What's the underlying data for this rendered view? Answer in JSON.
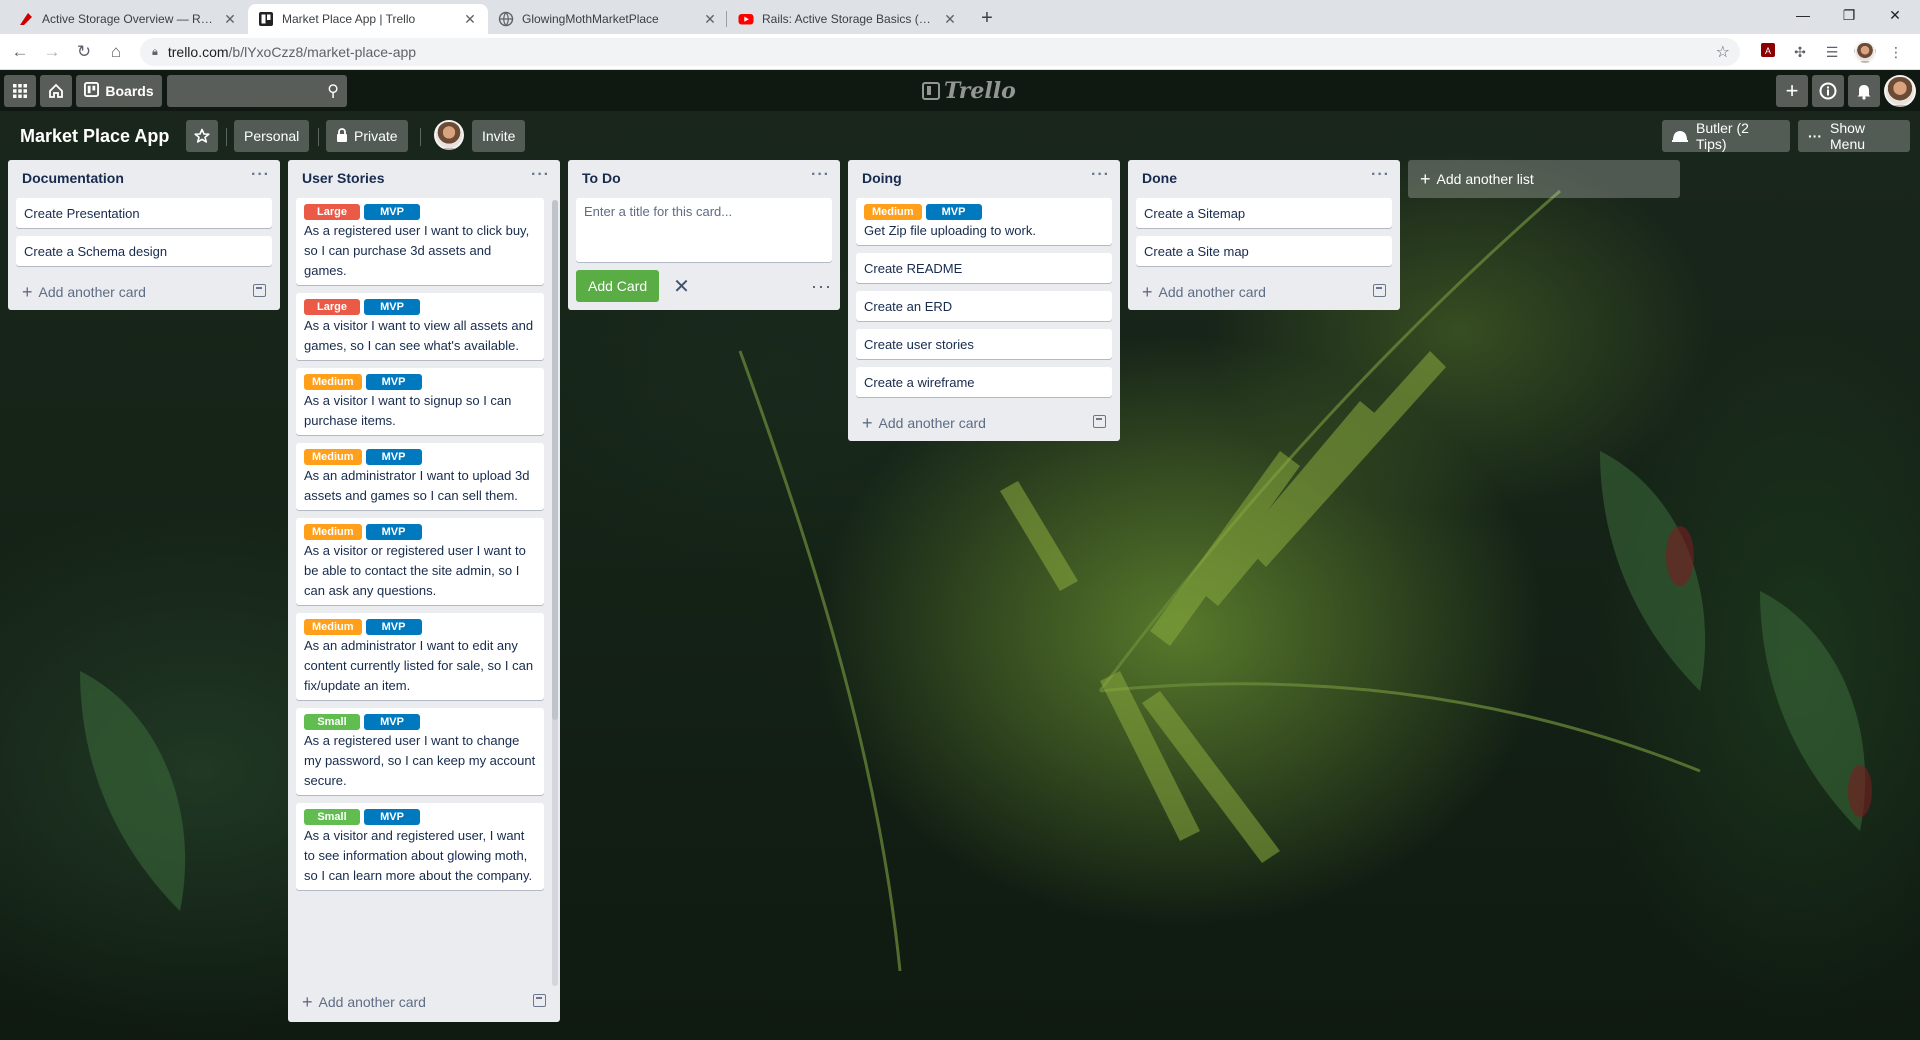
{
  "browser": {
    "tabs": [
      {
        "title": "Active Storage Overview — Ruby",
        "active": false
      },
      {
        "title": "Market Place App | Trello",
        "active": true
      },
      {
        "title": "GlowingMothMarketPlace",
        "active": false
      },
      {
        "title": "Rails: Active Storage Basics (File U",
        "active": false
      }
    ],
    "url_host": "trello.com",
    "url_path": "/b/lYxoCzz8/market-place-app",
    "window_controls": [
      "minimize",
      "maximize",
      "close"
    ]
  },
  "trello_header": {
    "boards_label": "Boards",
    "logo_text": "Trello",
    "search_placeholder": ""
  },
  "board": {
    "title": "Market Place App",
    "personal_label": "Personal",
    "private_label": "Private",
    "invite_label": "Invite",
    "butler_label": "Butler (2 Tips)",
    "show_menu_label": "Show Menu"
  },
  "lists": [
    {
      "title": "Documentation",
      "footer": "Add another card",
      "cards": [
        {
          "labels": [],
          "text": "Create Presentation"
        },
        {
          "labels": [],
          "text": "Create a Schema design"
        }
      ]
    },
    {
      "title": "User Stories",
      "footer": "Add another card",
      "cards": [
        {
          "labels": [
            "Large",
            "MVP"
          ],
          "text": "As a registered user I want to click buy, so I can purchase 3d assets and games."
        },
        {
          "labels": [
            "Large",
            "MVP"
          ],
          "text": "As a visitor I want to view all assets and games, so I can see what's available."
        },
        {
          "labels": [
            "Medium",
            "MVP"
          ],
          "text": "As a visitor I want to signup so I can purchase items."
        },
        {
          "labels": [
            "Medium",
            "MVP"
          ],
          "text": "As an administrator I want to upload 3d assets and games so I can sell them."
        },
        {
          "labels": [
            "Medium",
            "MVP"
          ],
          "text": "As a visitor or registered user I want to be able to contact the site admin, so I can ask any questions."
        },
        {
          "labels": [
            "Medium",
            "MVP"
          ],
          "text": "As an administrator I want to edit any content currently listed for sale, so I can fix/update an item."
        },
        {
          "labels": [
            "Small",
            "MVP"
          ],
          "text": "As a registered user I want to change my password, so I can keep my account secure."
        },
        {
          "labels": [
            "Small",
            "MVP"
          ],
          "text": "As a visitor and registered user, I want to see information about glowing moth, so I can learn more about the company."
        }
      ]
    },
    {
      "title": "To Do",
      "composer_placeholder": "Enter a title for this card...",
      "add_card_label": "Add Card",
      "cards": []
    },
    {
      "title": "Doing",
      "footer": "Add another card",
      "cards": [
        {
          "labels": [
            "Medium",
            "MVP"
          ],
          "text": "Get Zip file uploading to work."
        },
        {
          "labels": [],
          "text": "Create README"
        },
        {
          "labels": [],
          "text": "Create an ERD"
        },
        {
          "labels": [],
          "text": "Create user stories"
        },
        {
          "labels": [],
          "text": "Create a wireframe"
        }
      ]
    },
    {
      "title": "Done",
      "footer": "Add another card",
      "cards": [
        {
          "labels": [],
          "text": "Create a Sitemap"
        },
        {
          "labels": [],
          "text": "Create a Site map"
        }
      ]
    }
  ],
  "add_list_label": "Add another list",
  "colors": {
    "label_large": "#eb5a46",
    "label_medium": "#ff9f1a",
    "label_small": "#61bd4f",
    "label_mvp": "#0079bf",
    "add_card_button": "#5aac44",
    "list_bg": "#ebecf0"
  }
}
